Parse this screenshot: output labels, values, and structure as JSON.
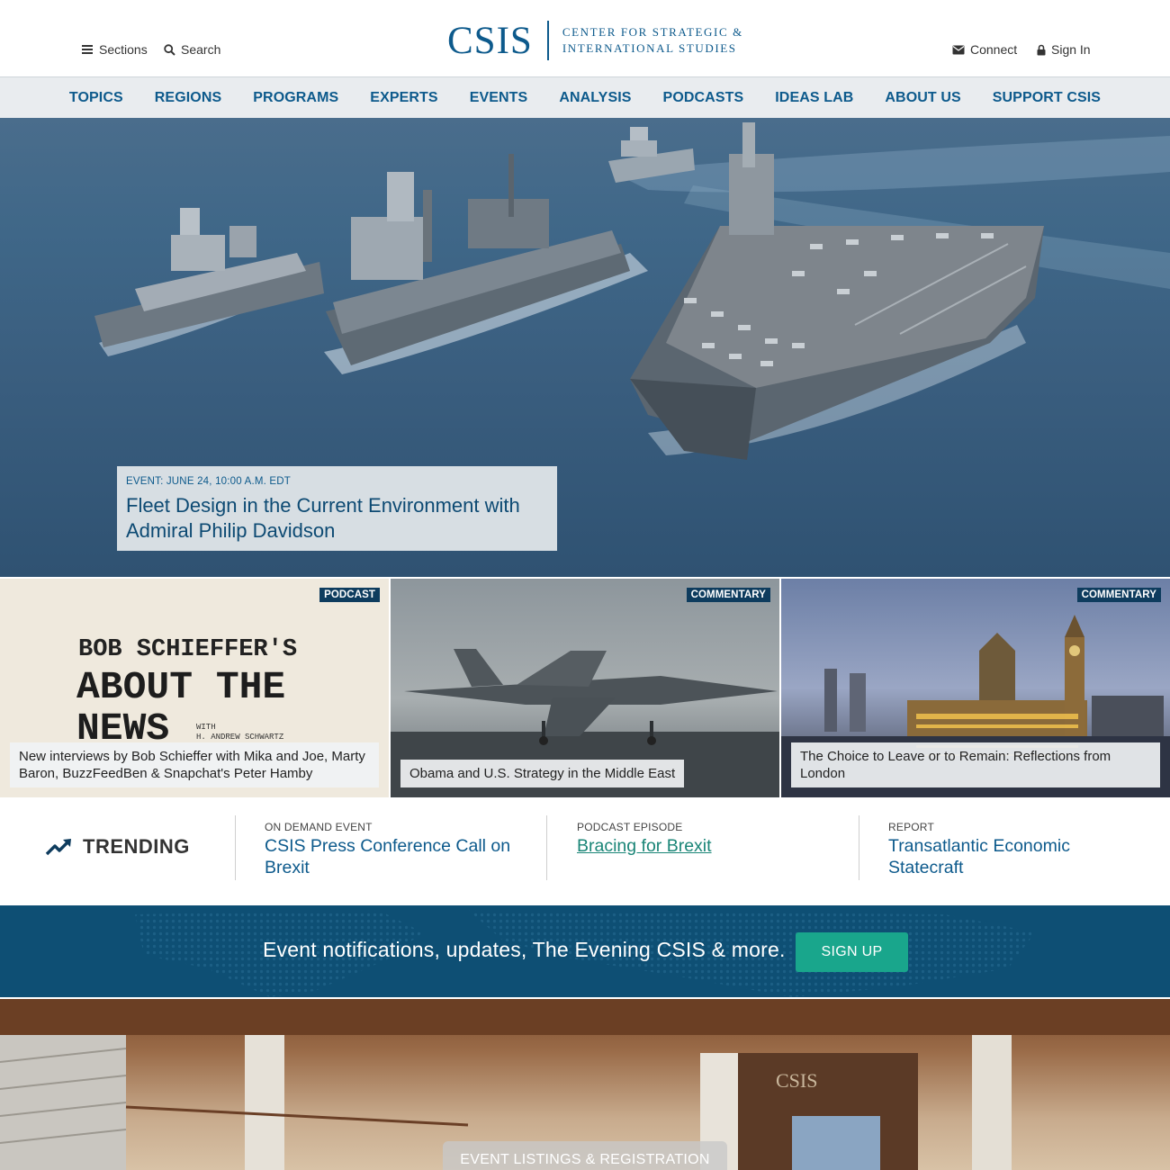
{
  "header": {
    "sections_label": "Sections",
    "search_label": "Search",
    "connect_label": "Connect",
    "signin_label": "Sign In",
    "logo_mark": "CSIS",
    "logo_line1": "CENTER FOR STRATEGIC &",
    "logo_line2": "INTERNATIONAL STUDIES"
  },
  "nav": {
    "items": [
      "TOPICS",
      "REGIONS",
      "PROGRAMS",
      "EXPERTS",
      "EVENTS",
      "ANALYSIS",
      "PODCASTS",
      "IDEAS LAB",
      "ABOUT US",
      "SUPPORT CSIS"
    ]
  },
  "hero": {
    "kicker": "EVENT: JUNE 24, 10:00 A.M. EDT",
    "title": "Fleet Design in the Current Environment with Admiral Philip Davidson"
  },
  "tiles": [
    {
      "tag": "PODCAST",
      "art_line1": "BOB SCHIEFFER'S",
      "art_line2": "ABOUT THE",
      "art_line3": "NEWS",
      "art_with": "WITH",
      "art_byline": "H. ANDREW SCHWARTZ",
      "caption": "New interviews by Bob Schieffer with Mika and Joe, Marty Baron, BuzzFeedBen & Snapchat's Peter Hamby"
    },
    {
      "tag": "COMMENTARY",
      "caption": "Obama and U.S. Strategy in the Middle East"
    },
    {
      "tag": "COMMENTARY",
      "caption": "The Choice to Leave or to Remain: Reflections from London"
    }
  ],
  "trending": {
    "label": "TRENDING",
    "items": [
      {
        "kicker": "ON DEMAND EVENT",
        "title": "CSIS Press Conference Call on Brexit"
      },
      {
        "kicker": "PODCAST EPISODE",
        "title": "Bracing for Brexit"
      },
      {
        "kicker": "REPORT",
        "title": "Transatlantic Economic Statecraft"
      }
    ]
  },
  "signup": {
    "text": "Event notifications, updates, The Evening CSIS & more.",
    "button": "SIGN UP"
  },
  "lobby": {
    "button": "EVENT LISTINGS & REGISTRATION",
    "wall_sign": "CSIS"
  },
  "colors": {
    "brand_blue": "#0d5a8c",
    "tag_navy": "#0e3c5e",
    "signup_band": "#0e4f74",
    "signup_button": "#19a68c",
    "nav_bg": "#e9ecef"
  }
}
